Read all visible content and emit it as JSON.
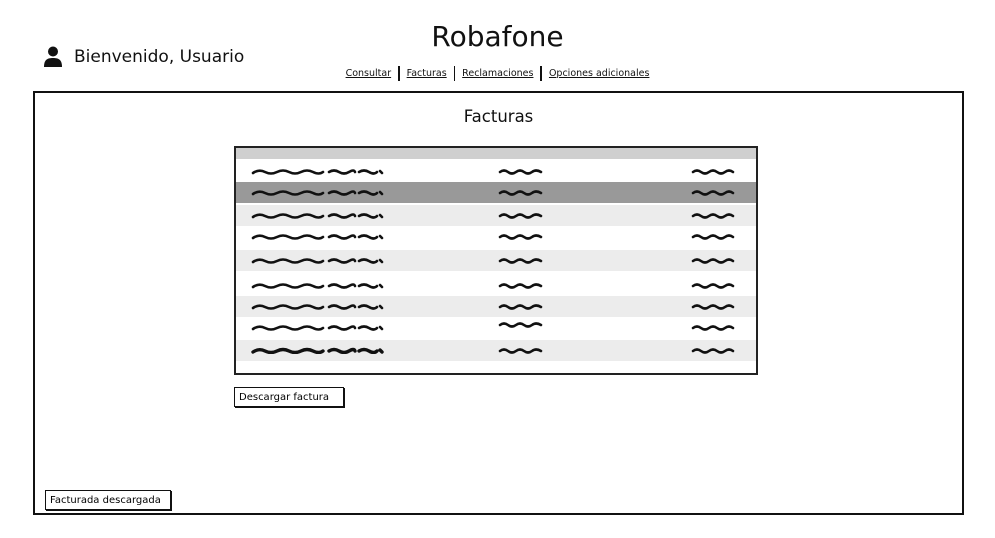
{
  "header": {
    "greeting": "Bienvenido, Usuario",
    "title": "Robafone"
  },
  "nav": {
    "items": [
      "Consultar",
      "Facturas",
      "Reclamaciones",
      "Opciones adicionales"
    ]
  },
  "main": {
    "section_title": "Facturas",
    "table": {
      "selected_row_index": 1,
      "row_count": 9
    },
    "download_button": "Descargar factura",
    "status_button": "Facturada descargada"
  },
  "colors": {
    "table_header": "#cfcfcf",
    "row_alt": "#ececec",
    "row_selected": "#999999"
  },
  "icons": {
    "user": "user-icon"
  }
}
